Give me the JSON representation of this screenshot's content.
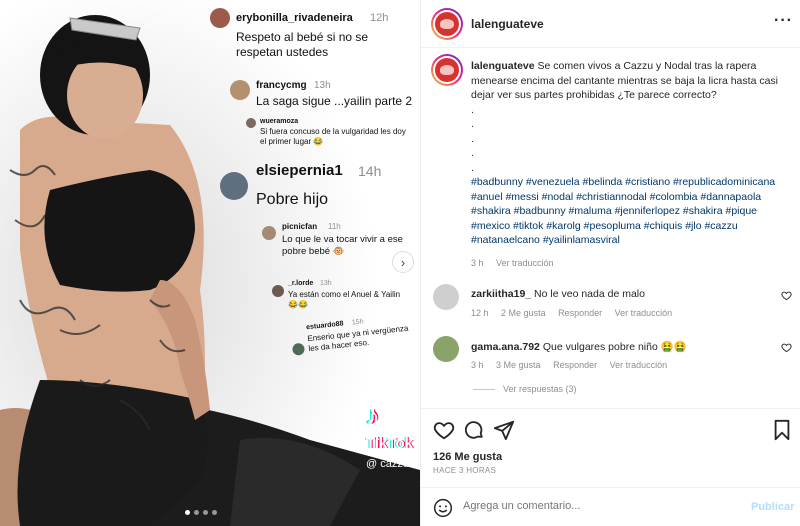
{
  "media": {
    "overlay_comments": [
      {
        "user": "erybonilla_rivadeneira",
        "time": "12h",
        "text": "Respeto al bebé si no se respetan ustedes"
      },
      {
        "user": "francycmg",
        "time": "13h",
        "text": "La saga sigue ...yailin parte 2"
      },
      {
        "user": "wueramoza",
        "time": "",
        "text": "Si fuera concuso de la vulgaridad les doy el primer lugar 😂"
      },
      {
        "user": "elsiepernia1",
        "time": "14h",
        "text": "Pobre hijo"
      },
      {
        "user": "picnicfan",
        "time": "11h",
        "text": "Lo que le va tocar vivir a ese pobre bebé 🐵"
      },
      {
        "user": "_r.lorde",
        "time": "13h",
        "text": "Ya están como el Anuel & Yailin 😂😂"
      },
      {
        "user": "estuardo88",
        "time": "15h",
        "text": "Enserio que ya ni vergüenza les da hacer eso."
      }
    ],
    "watermark": {
      "logo": "♪",
      "brand": "TikTok",
      "handle": "@ cazzu"
    }
  },
  "header": {
    "username": "lalenguateve"
  },
  "caption": {
    "username": "lalenguateve",
    "text": "Se comen vivos a Cazzu y Nodal tras la rapera menearse encima del cantante mientras se baja la licra hasta casi dejar ver sus partes prohibidas ¿Te parece correcto?",
    "dots": [
      ".",
      ".",
      ".",
      ".",
      "."
    ],
    "hashtags": "#badbunny #venezuela #belinda #cristiano #republicadominicana #anuel #messi #nodal #christiannodal #colombia #dannapaola #shakira #badbunny #maluma #jenniferlopez #shakira #pique #mexico #tiktok #karolg #pesopluma #chiquis #jlo #cazzu #natanaelcano #yailinlamasviral",
    "time": "3 h",
    "translate": "Ver traducción"
  },
  "comments": [
    {
      "user": "zarkiitha19_",
      "text": "No le veo nada de malo",
      "time": "12 h",
      "likes": "2 Me gusta",
      "reply": "Responder",
      "translate": "Ver traducción"
    },
    {
      "user": "gama.ana.792",
      "text": "Que vulgares pobre niño 🤮🤮",
      "time": "3 h",
      "likes": "3 Me gusta",
      "reply": "Responder",
      "translate": "Ver traducción"
    }
  ],
  "view_replies": "Ver respuestas (3)",
  "footer": {
    "likes": "126 Me gusta",
    "ago": "HACE 3 HORAS",
    "comment_placeholder": "Agrega un comentario...",
    "publish": "Publicar"
  },
  "colors": {
    "link": "#00376b",
    "publish": "#b2dffc",
    "muted": "#8e8e8e"
  }
}
